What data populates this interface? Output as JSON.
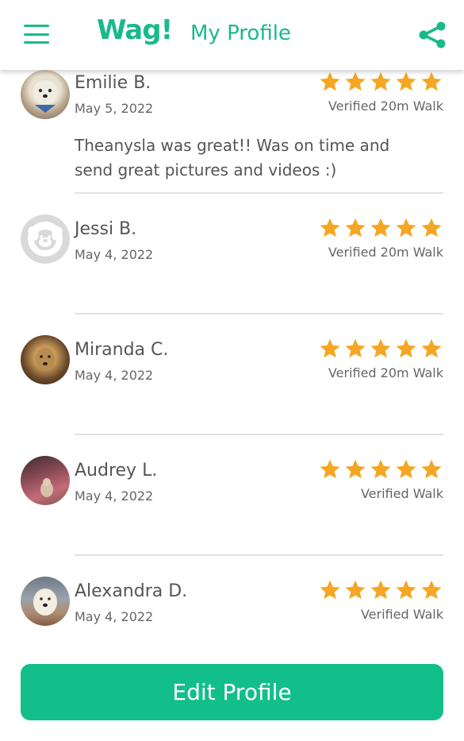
{
  "header": {
    "logo_text": "Wag!",
    "title": "My Profile",
    "menu_icon": "hamburger-menu-icon",
    "share_icon": "share-icon"
  },
  "colors": {
    "brand": "#1ab98b",
    "button": "#12bf8a",
    "star": "#f5a623"
  },
  "reviews": [
    {
      "name": "Emilie B.",
      "date": "May 5, 2022",
      "rating": 5,
      "walk": "Verified 20m Walk",
      "comment": "Theanysla was great!! Was on time and send great pictures and videos :)"
    },
    {
      "name": "Jessi B.",
      "date": "May 4, 2022",
      "rating": 5,
      "walk": "Verified 20m Walk",
      "comment": ""
    },
    {
      "name": "Miranda C.",
      "date": "May 4, 2022",
      "rating": 5,
      "walk": "Verified 20m Walk",
      "comment": ""
    },
    {
      "name": "Audrey L.",
      "date": "May 4, 2022",
      "rating": 5,
      "walk": "Verified Walk",
      "comment": ""
    },
    {
      "name": "Alexandra D.",
      "date": "May 4, 2022",
      "rating": 5,
      "walk": "Verified Walk",
      "comment": ""
    }
  ],
  "footer": {
    "edit_label": "Edit Profile"
  }
}
